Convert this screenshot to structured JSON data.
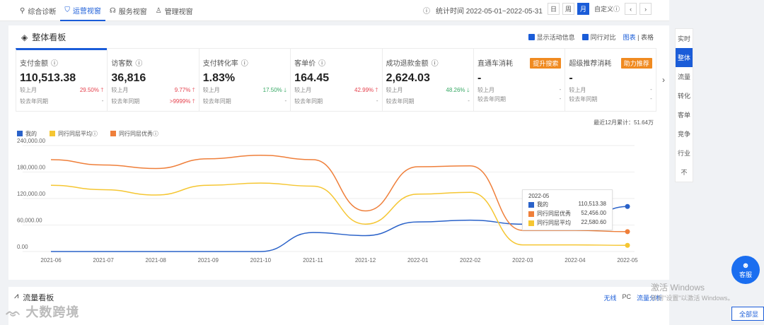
{
  "header": {
    "tabs": [
      {
        "label": "综合诊断",
        "icon": "pin-icon"
      },
      {
        "label": "运营视窗",
        "icon": "shield-icon",
        "active": true
      },
      {
        "label": "服务视窗",
        "icon": "headset-icon"
      },
      {
        "label": "管理视窗",
        "icon": "person-icon"
      }
    ],
    "stat_time": "统计时间 2022-05-01~2022-05-31",
    "periods": [
      "日",
      "周",
      "月"
    ],
    "active_period": "月",
    "custom_label": "自定义"
  },
  "overview": {
    "title": "整体看板",
    "options": {
      "show_activity": "显示活动信息",
      "peer_compare": "同行对比",
      "view_chart": "图表",
      "view_table": "表格"
    },
    "metrics": [
      {
        "label": "支付金额",
        "value": "110,513.38",
        "mom_label": "较上月",
        "mom": "29.50%",
        "mom_dir": "up",
        "yoy_label": "较去年同期",
        "yoy": "-",
        "selected": true
      },
      {
        "label": "访客数",
        "value": "36,816",
        "mom_label": "较上月",
        "mom": "9.77%",
        "mom_dir": "up",
        "yoy_label": "较去年同期",
        "yoy": ">9999%",
        "yoy_dir": "up"
      },
      {
        "label": "支付转化率",
        "value": "1.83%",
        "mom_label": "较上月",
        "mom": "17.50%",
        "mom_dir": "down",
        "yoy_label": "较去年同期",
        "yoy": "-"
      },
      {
        "label": "客单价",
        "value": "164.45",
        "mom_label": "较上月",
        "mom": "42.99%",
        "mom_dir": "up",
        "yoy_label": "较去年同期",
        "yoy": "-"
      },
      {
        "label": "成功退款金额",
        "value": "2,624.03",
        "mom_label": "较上月",
        "mom": "48.26%",
        "mom_dir": "down",
        "yoy_label": "较去年同期",
        "yoy": "-"
      },
      {
        "label": "直通车消耗",
        "value": "-",
        "badge": "提升搜索",
        "mom_label": "较上月",
        "mom": "-",
        "yoy_label": "较去年同期",
        "yoy": "-"
      },
      {
        "label": "超级推荐消耗",
        "value": "-",
        "badge": "助力推荐",
        "mom_label": "较上月",
        "mom": "-",
        "yoy_label": "较去年同期",
        "yoy": "-"
      }
    ],
    "total_note": "最近12月累计：51.64万"
  },
  "chart_data": {
    "type": "line",
    "x": [
      "2021-06",
      "2021-07",
      "2021-08",
      "2021-09",
      "2021-10",
      "2021-11",
      "2021-12",
      "2022-01",
      "2022-02",
      "2022-03",
      "2022-04",
      "2022-05"
    ],
    "ylim": [
      0,
      240000
    ],
    "yticks": [
      "0.00",
      "60,000.00",
      "120,000.00",
      "180,000.00",
      "240,000.00"
    ],
    "series": [
      {
        "name": "我的",
        "color": "#2a62c9",
        "values": [
          0,
          0,
          0,
          0,
          0,
          43000,
          36000,
          67000,
          71000,
          62000,
          63000,
          102000
        ]
      },
      {
        "name": "同行同层平均",
        "color": "#f5c632",
        "values": [
          150000,
          140000,
          128000,
          150000,
          155000,
          148000,
          62000,
          130000,
          134000,
          15000,
          15000,
          14000
        ]
      },
      {
        "name": "同行同层优秀",
        "color": "#ef7f3a",
        "values": [
          208000,
          196000,
          188000,
          210000,
          218000,
          208000,
          92000,
          192000,
          194000,
          48000,
          48000,
          45000
        ]
      }
    ],
    "tooltip": {
      "title": "2022-05",
      "rows": [
        {
          "name": "我的",
          "value": "110,513.38",
          "color": "#2a62c9"
        },
        {
          "name": "同行同层优秀",
          "value": "52,456.00",
          "color": "#ef7f3a"
        },
        {
          "name": "同行同层平均",
          "value": "22,580.60",
          "color": "#f5c632"
        }
      ]
    }
  },
  "sidebar": {
    "items": [
      "实时",
      "整体",
      "流量",
      "转化",
      "客单",
      "竞争",
      "行业",
      "不"
    ],
    "active": "整体"
  },
  "customer_service": {
    "label": "客服"
  },
  "flow": {
    "title": "流量看板",
    "options": [
      "无线",
      "PC",
      "流量分析"
    ]
  },
  "watermark": {
    "logo": "大数跨境",
    "win_line1": "激活 Windows",
    "win_line2": "转到\"设置\"以激活 Windows。"
  },
  "all_button": "全部显"
}
